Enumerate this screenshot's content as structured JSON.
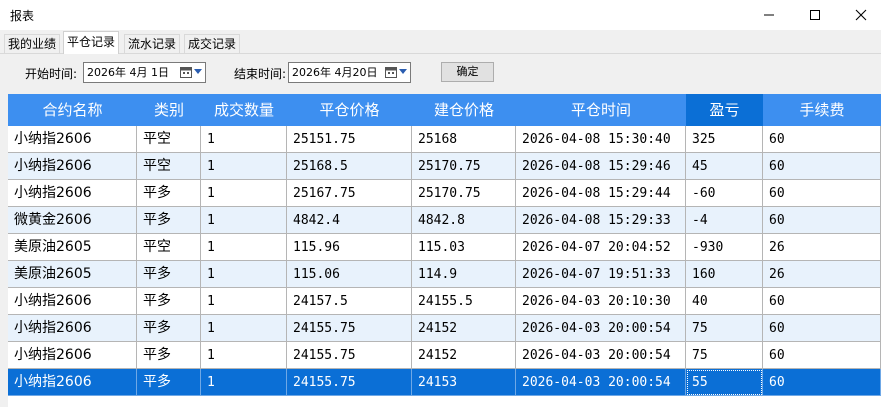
{
  "window": {
    "title": "报表"
  },
  "tabs": [
    {
      "label": "我的业绩",
      "active": false
    },
    {
      "label": "平仓记录",
      "active": true
    },
    {
      "label": "流水记录",
      "active": false
    },
    {
      "label": "成交记录",
      "active": false
    }
  ],
  "filters": {
    "start_label": "开始时间:",
    "start_value": "2026年 4月 1日",
    "end_label": "结束时间:",
    "end_value": "2026年 4月20日",
    "confirm_label": "确定"
  },
  "table": {
    "columns": [
      "合约名称",
      "类别",
      "成交数量",
      "平仓价格",
      "建仓价格",
      "平仓时间",
      "盈亏",
      "手续费"
    ],
    "rows": [
      [
        "小纳指2606",
        "平空",
        "1",
        "25151.75",
        "25168",
        "2026-04-08 15:30:40",
        "325",
        "60"
      ],
      [
        "小纳指2606",
        "平空",
        "1",
        "25168.5",
        "25170.75",
        "2026-04-08 15:29:46",
        "45",
        "60"
      ],
      [
        "小纳指2606",
        "平多",
        "1",
        "25167.75",
        "25170.75",
        "2026-04-08 15:29:44",
        "-60",
        "60"
      ],
      [
        "微黄金2606",
        "平多",
        "1",
        "4842.4",
        "4842.8",
        "2026-04-08 15:29:33",
        "-4",
        "60"
      ],
      [
        "美原油2605",
        "平空",
        "1",
        "115.96",
        "115.03",
        "2026-04-07 20:04:52",
        "-930",
        "26"
      ],
      [
        "美原油2605",
        "平多",
        "1",
        "115.06",
        "114.9",
        "2026-04-07 19:51:33",
        "160",
        "26"
      ],
      [
        "小纳指2606",
        "平多",
        "1",
        "24157.5",
        "24155.5",
        "2026-04-03 20:10:30",
        "40",
        "60"
      ],
      [
        "小纳指2606",
        "平多",
        "1",
        "24155.75",
        "24152",
        "2026-04-03 20:00:54",
        "75",
        "60"
      ],
      [
        "小纳指2606",
        "平多",
        "1",
        "24155.75",
        "24152",
        "2026-04-03 20:00:54",
        "75",
        "60"
      ],
      [
        "小纳指2606",
        "平多",
        "1",
        "24155.75",
        "24153",
        "2026-04-03 20:00:54",
        "55",
        "60"
      ]
    ],
    "selected_row": 9,
    "sorted_column": 6
  },
  "colors": {
    "header": "#3d8ff0",
    "header_selected": "#0b6fd6",
    "row_alt": "#e8f2fc",
    "row_selected": "#0b6fd6"
  }
}
